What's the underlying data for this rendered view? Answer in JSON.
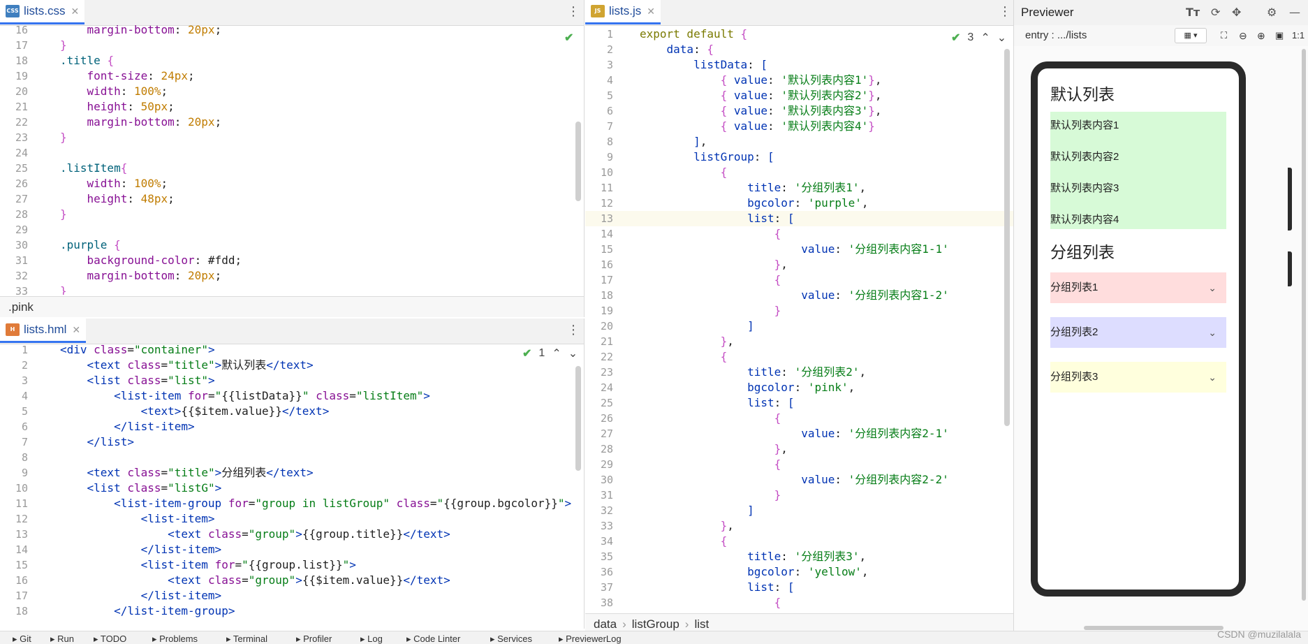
{
  "css_editor": {
    "tab": {
      "badge": "CSS",
      "name": "lists.css"
    },
    "status_hint": ".pink",
    "lines": [
      {
        "n": "16",
        "html": "    <span class='p'>margin-bottom</span>: <span class='num'>20px</span>;"
      },
      {
        "n": "17",
        "html": "<span class='br'>}</span>"
      },
      {
        "n": "18",
        "html": "<span class='sel'>.title</span> <span class='br'>{</span>"
      },
      {
        "n": "19",
        "html": "    <span class='p'>font-size</span>: <span class='num'>24px</span>;"
      },
      {
        "n": "20",
        "html": "    <span class='p'>width</span>: <span class='num'>100%</span>;"
      },
      {
        "n": "21",
        "html": "    <span class='p'>height</span>: <span class='num'>50px</span>;"
      },
      {
        "n": "22",
        "html": "    <span class='p'>margin-bottom</span>: <span class='num'>20px</span>;"
      },
      {
        "n": "23",
        "html": "<span class='br'>}</span>"
      },
      {
        "n": "24",
        "html": ""
      },
      {
        "n": "25",
        "html": "<span class='sel'>.listItem</span><span class='br'>{</span>"
      },
      {
        "n": "26",
        "html": "    <span class='p'>width</span>: <span class='num'>100%</span>;"
      },
      {
        "n": "27",
        "html": "    <span class='p'>height</span>: <span class='num'>48px</span>;"
      },
      {
        "n": "28",
        "html": "<span class='br'>}</span>"
      },
      {
        "n": "29",
        "html": ""
      },
      {
        "n": "30",
        "html": "<span class='sel'>.purple</span> <span class='br'>{</span>"
      },
      {
        "n": "31",
        "html": "    <span class='p'>background-color</span>: <span class='pl'>#fdd</span>;"
      },
      {
        "n": "32",
        "html": "    <span class='p'>margin-bottom</span>: <span class='num'>20px</span>;"
      },
      {
        "n": "33",
        "html": "<span class='br'>}</span>"
      }
    ]
  },
  "hml_editor": {
    "tab": {
      "badge": "H",
      "name": "lists.hml"
    },
    "inspection": "1",
    "lines": [
      {
        "n": "1",
        "html": "<span class='tag'>&lt;div</span> <span class='p'>class</span>=<span class='s'>\"container\"</span><span class='tag'>&gt;</span>"
      },
      {
        "n": "2",
        "html": "    <span class='tag'>&lt;text</span> <span class='p'>class</span>=<span class='s'>\"title\"</span><span class='tag'>&gt;</span>默认列表<span class='tag'>&lt;/text&gt;</span>"
      },
      {
        "n": "3",
        "html": "    <span class='tag'>&lt;list</span> <span class='p'>class</span>=<span class='s'>\"list\"</span><span class='tag'>&gt;</span>"
      },
      {
        "n": "4",
        "html": "        <span class='tag'>&lt;list-item</span> <span class='p'>for</span>=<span class='s'>\"</span>{{listData}}<span class='s'>\"</span> <span class='p'>class</span>=<span class='s'>\"listItem\"</span><span class='tag'>&gt;</span>"
      },
      {
        "n": "5",
        "html": "            <span class='tag'>&lt;text&gt;</span>{{$item.value}}<span class='tag'>&lt;/text&gt;</span>"
      },
      {
        "n": "6",
        "html": "        <span class='tag'>&lt;/list-item&gt;</span>"
      },
      {
        "n": "7",
        "html": "    <span class='tag'>&lt;/list&gt;</span>"
      },
      {
        "n": "8",
        "html": ""
      },
      {
        "n": "9",
        "html": "    <span class='tag'>&lt;text</span> <span class='p'>class</span>=<span class='s'>\"title\"</span><span class='tag'>&gt;</span>分组列表<span class='tag'>&lt;/text&gt;</span>"
      },
      {
        "n": "10",
        "html": "    <span class='tag'>&lt;list</span> <span class='p'>class</span>=<span class='s'>\"listG\"</span><span class='tag'>&gt;</span>"
      },
      {
        "n": "11",
        "html": "        <span class='tag'>&lt;list-item-group</span> <span class='p'>for</span>=<span class='s'>\"group in listGroup\"</span> <span class='p'>class</span>=<span class='s'>\"</span>{{group.bgcolor}}<span class='s'>\"</span><span class='tag'>&gt;</span>"
      },
      {
        "n": "12",
        "html": "            <span class='tag'>&lt;list-item&gt;</span>"
      },
      {
        "n": "13",
        "html": "                <span class='tag'>&lt;text</span> <span class='p'>class</span>=<span class='s'>\"group\"</span><span class='tag'>&gt;</span>{{group.title}}<span class='tag'>&lt;/text&gt;</span>"
      },
      {
        "n": "14",
        "html": "            <span class='tag'>&lt;/list-item&gt;</span>"
      },
      {
        "n": "15",
        "html": "            <span class='tag'>&lt;list-item</span> <span class='p'>for</span>=<span class='s'>\"</span>{{group.list}}<span class='s'>\"</span><span class='tag'>&gt;</span>"
      },
      {
        "n": "16",
        "html": "                <span class='tag'>&lt;text</span> <span class='p'>class</span>=<span class='s'>\"group\"</span><span class='tag'>&gt;</span>{{$item.value}}<span class='tag'>&lt;/text&gt;</span>"
      },
      {
        "n": "17",
        "html": "            <span class='tag'>&lt;/list-item&gt;</span>"
      },
      {
        "n": "18",
        "html": "        <span class='tag'>&lt;/list-item-group&gt;</span>"
      }
    ]
  },
  "js_editor": {
    "tab": {
      "badge": "JS",
      "name": "lists.js"
    },
    "inspection": "3",
    "current_line": "13",
    "breadcrumb": [
      "data",
      "listGroup",
      "list"
    ],
    "lines": [
      {
        "n": "1",
        "html": "<span class='kw'>export default</span> <span class='br'>{</span>"
      },
      {
        "n": "2",
        "html": "    <span class='k'>data</span>: <span class='br'>{</span>"
      },
      {
        "n": "3",
        "html": "        <span class='k'>listData</span>: <span class='k'>[</span>"
      },
      {
        "n": "4",
        "html": "            <span class='br'>{</span> <span class='k'>value</span>: <span class='s'>'默认列表内容1'</span><span class='br'>}</span>,"
      },
      {
        "n": "5",
        "html": "            <span class='br'>{</span> <span class='k'>value</span>: <span class='s'>'默认列表内容2'</span><span class='br'>}</span>,"
      },
      {
        "n": "6",
        "html": "            <span class='br'>{</span> <span class='k'>value</span>: <span class='s'>'默认列表内容3'</span><span class='br'>}</span>,"
      },
      {
        "n": "7",
        "html": "            <span class='br'>{</span> <span class='k'>value</span>: <span class='s'>'默认列表内容4'</span><span class='br'>}</span>"
      },
      {
        "n": "8",
        "html": "        <span class='k'>]</span>,"
      },
      {
        "n": "9",
        "html": "        <span class='k'>listGroup</span>: <span class='k'>[</span>"
      },
      {
        "n": "10",
        "html": "            <span class='br'>{</span>"
      },
      {
        "n": "11",
        "html": "                <span class='k'>title</span>: <span class='s'>'分组列表1'</span>,"
      },
      {
        "n": "12",
        "html": "                <span class='k'>bgcolor</span>: <span class='s'>'purple'</span>,"
      },
      {
        "n": "13",
        "html": "                <span class='k'>list</span>: <span class='k'>[</span>"
      },
      {
        "n": "14",
        "html": "                    <span class='br'>{</span>"
      },
      {
        "n": "15",
        "html": "                        <span class='k'>value</span>: <span class='s'>'分组列表内容1-1'</span>"
      },
      {
        "n": "16",
        "html": "                    <span class='br'>}</span>,"
      },
      {
        "n": "17",
        "html": "                    <span class='br'>{</span>"
      },
      {
        "n": "18",
        "html": "                        <span class='k'>value</span>: <span class='s'>'分组列表内容1-2'</span>"
      },
      {
        "n": "19",
        "html": "                    <span class='br'>}</span>"
      },
      {
        "n": "20",
        "html": "                <span class='k'>]</span>"
      },
      {
        "n": "21",
        "html": "            <span class='br'>}</span>,"
      },
      {
        "n": "22",
        "html": "            <span class='br'>{</span>"
      },
      {
        "n": "23",
        "html": "                <span class='k'>title</span>: <span class='s'>'分组列表2'</span>,"
      },
      {
        "n": "24",
        "html": "                <span class='k'>bgcolor</span>: <span class='s'>'pink'</span>,"
      },
      {
        "n": "25",
        "html": "                <span class='k'>list</span>: <span class='k'>[</span>"
      },
      {
        "n": "26",
        "html": "                    <span class='br'>{</span>"
      },
      {
        "n": "27",
        "html": "                        <span class='k'>value</span>: <span class='s'>'分组列表内容2-1'</span>"
      },
      {
        "n": "28",
        "html": "                    <span class='br'>}</span>,"
      },
      {
        "n": "29",
        "html": "                    <span class='br'>{</span>"
      },
      {
        "n": "30",
        "html": "                        <span class='k'>value</span>: <span class='s'>'分组列表内容2-2'</span>"
      },
      {
        "n": "31",
        "html": "                    <span class='br'>}</span>"
      },
      {
        "n": "32",
        "html": "                <span class='k'>]</span>"
      },
      {
        "n": "33",
        "html": "            <span class='br'>}</span>,"
      },
      {
        "n": "34",
        "html": "            <span class='br'>{</span>"
      },
      {
        "n": "35",
        "html": "                <span class='k'>title</span>: <span class='s'>'分组列表3'</span>,"
      },
      {
        "n": "36",
        "html": "                <span class='k'>bgcolor</span>: <span class='s'>'yellow'</span>,"
      },
      {
        "n": "37",
        "html": "                <span class='k'>list</span>: <span class='k'>[</span>"
      },
      {
        "n": "38",
        "html": "                    <span class='br'>{</span>"
      }
    ]
  },
  "previewer": {
    "title": "Previewer",
    "path": "entry : .../lists",
    "zoom_label": "1:1",
    "screen": {
      "default_title": "默认列表",
      "default_items": [
        "默认列表内容1",
        "默认列表内容2",
        "默认列表内容3",
        "默认列表内容4"
      ],
      "group_title": "分组列表",
      "groups": [
        {
          "label": "分组列表1",
          "color": "#ffdddd"
        },
        {
          "label": "分组列表2",
          "color": "#ddddff"
        },
        {
          "label": "分组列表3",
          "color": "#ffffdd"
        }
      ]
    }
  },
  "statusbar": {
    "items": [
      "Git",
      "Run",
      "TODO",
      "Problems",
      "Terminal",
      "Profiler",
      "Log",
      "Code Linter",
      "Services",
      "PreviewerLog"
    ]
  },
  "watermark": "CSDN @muzilalala",
  "colors": {
    "accent": "#3574f0",
    "list_green": "#d7fad7"
  }
}
